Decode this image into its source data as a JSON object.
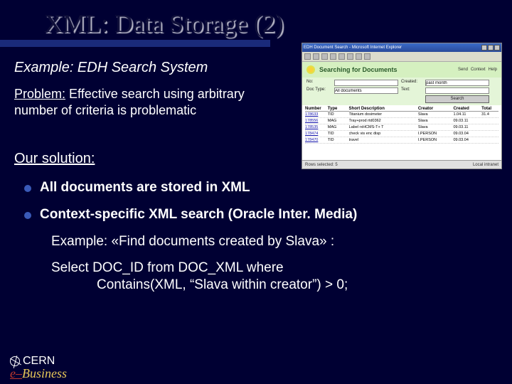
{
  "title": "XML: Data Storage (2)",
  "example_heading": "Example: EDH Search System",
  "problem": {
    "label": "Problem:",
    "text": " Effective search using arbitrary number of criteria is problematic"
  },
  "solution_heading": "Our solution:",
  "bullets": [
    "All documents are stored in XML",
    "Context-specific XML search (Oracle Inter. Media)"
  ],
  "example_line": "Example: «Find documents created by Slava» :",
  "sql": {
    "line1": "Select DOC_ID from DOC_XML where",
    "line2": "Contains(XML, “Slava within creator”) > 0;"
  },
  "footer": {
    "org": "CERN",
    "brand_e": "e",
    "brand_dash": "–",
    "brand_rest": "Business"
  },
  "thumb": {
    "window_title": "EDH Document Search - Microsoft Internet Explorer",
    "banner": "Searching for Documents",
    "tabs": [
      "Send",
      "Context",
      "Help"
    ],
    "form_labels": {
      "no": "No:",
      "type": "Doc Type:",
      "created": "Created:",
      "text": "Text:"
    },
    "form_values": {
      "type": "All documents",
      "created": "past month"
    },
    "search_btn": "Search",
    "headers": [
      "Number",
      "Type",
      "Short Description",
      "Creator",
      "Created",
      "Total"
    ],
    "rows": [
      [
        "178633",
        "TID",
        "Titanium dosimeter",
        "Slava",
        "1.04.11",
        "31.4"
      ],
      [
        "178556",
        "MAG",
        "Tray+prod rtd0362",
        "Slava",
        "09.03.11",
        ""
      ],
      [
        "178535",
        "MAG",
        "Label rxHCMS-T+ T",
        "Slava",
        "09.03.11",
        ""
      ],
      [
        "178474",
        "TID",
        "check vis enc disp",
        "I.PERSON",
        "09.03.04",
        ""
      ],
      [
        "178470",
        "TID",
        "travel",
        "I.PERSON",
        "09.03.04",
        ""
      ]
    ],
    "status_left": "Rows selected: 5",
    "status_right": "Local intranet"
  }
}
